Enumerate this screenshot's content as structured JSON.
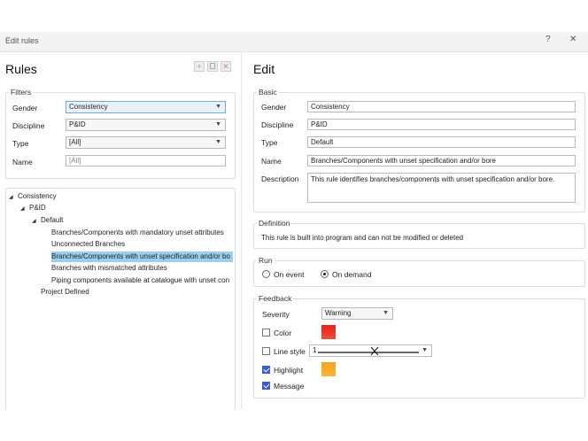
{
  "window": {
    "title": "Edit rules",
    "help_label": "?",
    "close_label": "✕"
  },
  "rules": {
    "heading": "Rules",
    "toolbar": {
      "add_icon": "plus-icon",
      "copy_icon": "copy-icon",
      "delete_icon": "delete-icon"
    },
    "filters": {
      "label": "Filters",
      "gender_label": "Gender",
      "gender_value": "Consistency",
      "discipline_label": "Discipline",
      "discipline_value": "P&ID",
      "type_label": "Type",
      "type_value": "[All]",
      "name_label": "Name",
      "name_placeholder": "[All]"
    },
    "tree": [
      "Consistency",
      "P&ID",
      "Default",
      "Branches/Components with mandatory unset attributes",
      "Unconnected Branches",
      "Branches/Components with unset specification and/or bo",
      "Branches with mismatched attributes",
      "Piping components available at catalogue with unset con",
      "Project Defined"
    ]
  },
  "edit": {
    "heading": "Edit",
    "basic": {
      "label": "Basic",
      "gender_label": "Gender",
      "gender_value": "Consistency",
      "discipline_label": "Discipline",
      "discipline_value": "P&ID",
      "type_label": "Type",
      "type_value": "Default",
      "name_label": "Name",
      "name_value": "Branches/Components with unset specification and/or bore",
      "description_label": "Description",
      "description_value": "This rule identifies branches/components with unset specification and/or bore."
    },
    "definition": {
      "label": "Definition",
      "text": "This rule is built into program and can not be modified or deleted"
    },
    "run": {
      "label": "Run",
      "on_event": "On event",
      "on_demand": "On demand",
      "selected": "On demand"
    },
    "feedback": {
      "label": "Feedback",
      "severity_label": "Severity",
      "severity_value": "Warning",
      "color_label": "Color",
      "color_checked": false,
      "color_value": "#e8201a",
      "linestyle_label": "Line style",
      "linestyle_checked": false,
      "linestyle_value": "1",
      "highlight_label": "Highlight",
      "highlight_checked": true,
      "highlight_value": "#f5a31c",
      "message_label": "Message",
      "message_checked": true
    }
  }
}
